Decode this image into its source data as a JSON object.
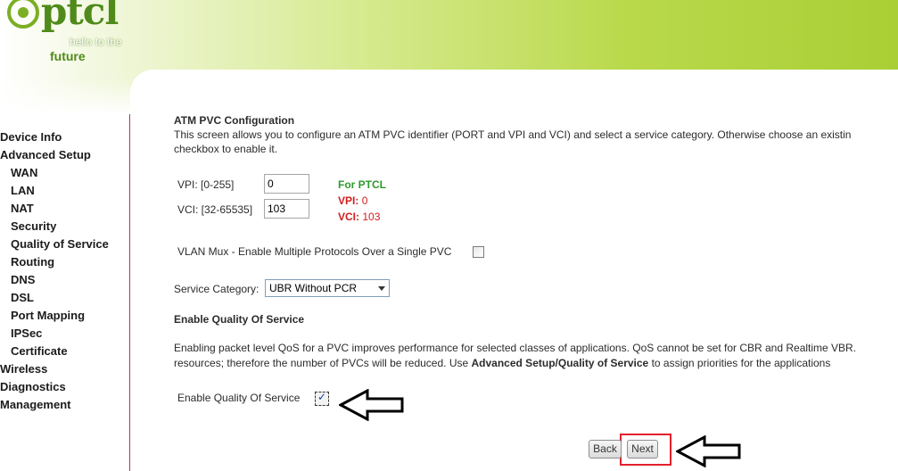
{
  "logo": {
    "brand": "ptcl",
    "tagline_1": "hello to the",
    "tagline_2": "future"
  },
  "sidebar": {
    "items": [
      {
        "label": "Device Info",
        "level": 0
      },
      {
        "label": "Advanced Setup",
        "level": 0
      },
      {
        "label": "WAN",
        "level": 1
      },
      {
        "label": "LAN",
        "level": 1
      },
      {
        "label": "NAT",
        "level": 1
      },
      {
        "label": "Security",
        "level": 1
      },
      {
        "label": "Quality of Service",
        "level": 1
      },
      {
        "label": "Routing",
        "level": 1
      },
      {
        "label": "DNS",
        "level": 1
      },
      {
        "label": "DSL",
        "level": 1
      },
      {
        "label": "Port Mapping",
        "level": 1
      },
      {
        "label": "IPSec",
        "level": 1
      },
      {
        "label": "Certificate",
        "level": 1
      },
      {
        "label": "Wireless",
        "level": 0
      },
      {
        "label": "Diagnostics",
        "level": 0
      },
      {
        "label": "Management",
        "level": 0
      }
    ]
  },
  "main": {
    "title": "ATM PVC Configuration",
    "description_line1": "This screen allows you to configure an ATM PVC identifier (PORT and VPI and VCI) and select a service category. Otherwise choose an existin",
    "description_line2": "checkbox to enable it.",
    "vpi": {
      "label": "VPI: [0-255]",
      "value": "0"
    },
    "vci": {
      "label": "VCI: [32-65535]",
      "value": "103"
    },
    "ptcl_note": {
      "title": "For PTCL",
      "vpi_key": "VPI:",
      "vpi_value": "0",
      "vci_key": "VCI:",
      "vci_value": "103"
    },
    "vlan_mux": {
      "label": "VLAN Mux - Enable Multiple Protocols Over a Single PVC",
      "checked": false
    },
    "service_category": {
      "label": "Service Category:",
      "selected": "UBR Without PCR"
    },
    "qos": {
      "section_title": "Enable Quality Of Service",
      "desc1": "Enabling packet level QoS for a PVC improves performance for selected classes of applications.  QoS cannot be set for CBR and Realtime VBR.",
      "desc2_a": "resources; therefore the number of PVCs will be reduced. Use ",
      "desc2_b": "Advanced Setup/Quality of Service",
      "desc2_c": " to assign priorities for the applications",
      "enable_label": "Enable Quality Of Service",
      "checked": true
    },
    "buttons": {
      "back": "Back",
      "next": "Next"
    }
  },
  "colors": {
    "brand_green": "#4f8a1a",
    "note_green": "#2e9a2b",
    "note_red": "#d01e1e",
    "highlight_red": "#e2202c",
    "sidebar_border": "#b5344a"
  }
}
